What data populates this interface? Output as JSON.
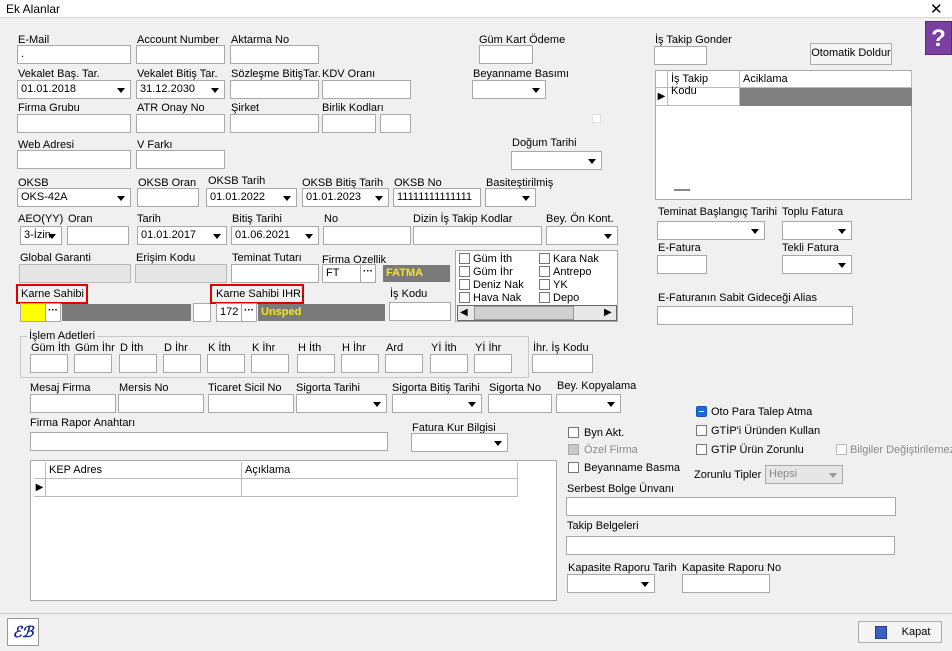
{
  "window": {
    "title": "Ek Alanlar",
    "close": "✕"
  },
  "help": "?",
  "labels": {
    "email": "E-Mail",
    "account_number": "Account Number",
    "aktarma_no": "Aktarma No",
    "gum_kart_odeme": "Güm Kart Ödeme",
    "is_takip_gonder": "İş Takip Gonder",
    "vekalet_bas": "Vekalet Baş. Tar.",
    "vekalet_bitis": "Vekalet Bitiş Tar.",
    "sozlesme_bitis": "Sözleşme BitişTar.",
    "kdv_orani": "KDV Oranı",
    "beyanname_basimi": "Beyanname Basımı",
    "firma_grubu": "Firma Grubu",
    "atr_onay_no": "ATR Onay No",
    "sirket": "Şirket",
    "birlik_kodlari": "Birlik Kodları",
    "web_adresi": "Web Adresi",
    "v_farki": "V Farkı",
    "dogum_tarihi": "Doğum Tarihi",
    "oksb": "OKSB",
    "oksb_oran": "OKSB Oran",
    "oksb_tarih": "OKSB Tarih",
    "oksb_bitis": "OKSB Bitiş Tarih",
    "oksb_no": "OKSB No",
    "basitestirilmis": "Basiteştirilmiş",
    "teminat_baslangic": "Teminat Başlangıç Tarihi",
    "toplu_fatura": "Toplu Fatura",
    "aeo_yy": "AEO(YY)",
    "oran": "Oran",
    "tarih": "Tarih",
    "bitis_tarihi": "Bitiş Tarihi",
    "no": "No",
    "dizin_is_takip": "Dizin İş Takip Kodlar",
    "bey_on_kont": "Bey. Ön Kont.",
    "e_fatura": "E-Fatura",
    "tekli_fatura": "Tekli Fatura",
    "global_garanti": "Global Garanti",
    "erisim_kodu": "Erişim Kodu",
    "teminat_tutari": "Teminat Tutarı",
    "firma_ozellik": "Firma Ozellik",
    "karne_sahibi": "Karne Sahibi",
    "karne_sahibi_ihr": "Karne Sahibi IHR.",
    "is_kodu": "İş Kodu",
    "e_fatura_alias": "E-Faturanın Sabit Gideceği Alias",
    "islem_adetleri": "İşlem Adetleri",
    "ihr_is_kodu": "İhr. İş Kodu",
    "mesaj_firma": "Mesaj Firma",
    "mersis_no": "Mersis No",
    "ticaret_sicil_no": "Ticaret Sicil No",
    "sigorta_tarihi": "Sigorta Tarihi",
    "sigorta_bitis": "Sigorta Bitiş Tarihi",
    "sigorta_no": "Sigorta No",
    "bey_kopyalama": "Bey. Kopyalama",
    "firma_rapor_anahtari": "Firma Rapor Anahtarı",
    "fatura_kur_bilgisi": "Fatura Kur Bilgisi",
    "zorunlu_tipler": "Zorunlu Tipler",
    "serbest_bolge": "Serbest Bolge Ünvanı",
    "takip_belgeleri": "Takip Belgeleri",
    "kapasite_tarih": "Kapasite Raporu Tarih",
    "kapasite_no": "Kapasite Raporu No"
  },
  "values": {
    "email": ".",
    "vekalet_bas": "01.01.2018",
    "vekalet_bitis": "31.12.2030",
    "oksb": "OKS-42A",
    "oksb_tarih": "01.01.2022",
    "oksb_bitis": "01.01.2023",
    "oksb_no": "11111111111111",
    "aeo_yy": "3-İzin",
    "tarih": "01.01.2017",
    "bitis_tarihi": "01.06.2021",
    "firma_ozellik_code": "FT",
    "firma_ozellik_name": "FATMA",
    "karne_ihr_code": "172",
    "karne_ihr_name": "Unsped",
    "zorunlu_tipler": "Hepsi"
  },
  "buttons": {
    "otomatik_doldur": "Otomatik Doldur",
    "kapat": "Kapat",
    "dots": "···"
  },
  "is_takip_grid": {
    "columns": [
      "İş Takip Kodu",
      "Aciklama"
    ]
  },
  "kep_grid": {
    "columns": [
      "KEP Adres",
      "Açıklama"
    ]
  },
  "checkgroup": {
    "left": [
      "Güm İth",
      "Güm İhr",
      "Deniz Nak",
      "Hava Nak"
    ],
    "right": [
      "Kara Nak",
      "Antrepo",
      "YK",
      "Depo"
    ]
  },
  "islem_columns": [
    "Güm İth",
    "Güm İhr",
    "D İth",
    "D İhr",
    "K İth",
    "K İhr",
    "H İth",
    "H İhr",
    "Ard",
    "Yİ İth",
    "Yİ İhr"
  ],
  "options": {
    "byn_akt": "Byn Akt.",
    "ozel_firma": "Özel Firma",
    "beyanname_basma": "Beyanname Basma",
    "oto_para_talep": "Oto Para Talep Atma",
    "gtip_urunden": "GTİP'i Üründen Kullan",
    "gtip_urun_zorunlu": "GTİP Ürün Zorunlu",
    "bilgiler_degistirilemez": "Bilgiler Değiştirilemez"
  },
  "colors": {
    "accent": "#1e6bd6",
    "highlight": "#e00000",
    "name_box": "#7a7a7a",
    "name_text": "#f5e61e",
    "yellow_field": "#ffff00"
  }
}
